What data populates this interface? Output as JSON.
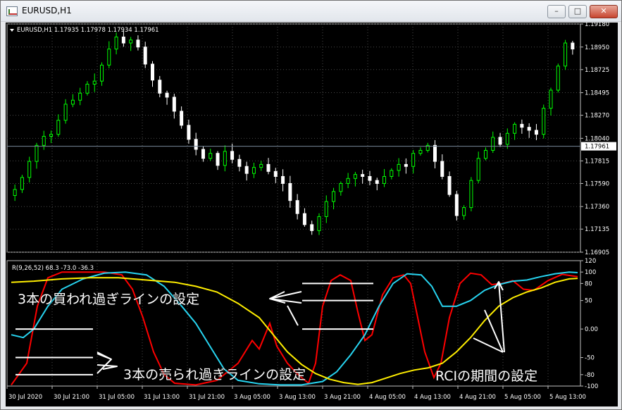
{
  "window": {
    "title": "EURUSD,H1",
    "min_glyph": "–",
    "max_glyph": "□",
    "close_glyph": "✕"
  },
  "price_chart": {
    "header": "EURUSD,H1  1.17935 1.17978 1.17934 1.17961",
    "price_labels": [
      "1.19180",
      "1.18950",
      "1.18725",
      "1.18495",
      "1.18270",
      "1.18040",
      "1.17815",
      "1.17590",
      "1.17360",
      "1.17135",
      "1.16905"
    ],
    "current_price": "1.17961",
    "bull_color": "#00ff00",
    "bear_color": "#ffffff"
  },
  "indicator": {
    "header": "R(9,26,52) 68.3 -73.0 -36.3",
    "levels": [
      "120",
      "100",
      "80",
      "50",
      "0.00",
      "-50",
      "-80",
      "-100"
    ],
    "series_colors": [
      "#ff0000",
      "#27d4f0",
      "#ffee00"
    ]
  },
  "time_labels": [
    "30 Jul 2020",
    "30 Jul 21:00",
    "31 Jul 05:00",
    "31 Jul 13:00",
    "31 Jul 21:00",
    "3 Aug 05:00",
    "3 Aug 13:00",
    "3 Aug 21:00",
    "4 Aug 05:00",
    "4 Aug 13:00",
    "4 Aug 21:00",
    "5 Aug 05:00",
    "5 Aug 13:00"
  ],
  "annotations": {
    "overbought": "3本の買われ過ぎラインの設定",
    "oversold": "3本の売られ過ぎラインの設定",
    "period": "RCIの期間の設定"
  },
  "chart_data": {
    "type": "candlestick",
    "symbol": "EURUSD",
    "timeframe": "H1",
    "ylim": [
      1.16905,
      1.1918
    ],
    "close_series_approx": [
      1.1753,
      1.1765,
      1.1781,
      1.1797,
      1.1806,
      1.1808,
      1.1822,
      1.1838,
      1.1842,
      1.1849,
      1.1858,
      1.1861,
      1.1877,
      1.1893,
      1.1905,
      1.1899,
      1.1902,
      1.1895,
      1.1878,
      1.1862,
      1.1849,
      1.1845,
      1.1831,
      1.1817,
      1.1803,
      1.1793,
      1.1784,
      1.1789,
      1.1777,
      1.1791,
      1.1783,
      1.1776,
      1.1769,
      1.1775,
      1.1778,
      1.1771,
      1.1766,
      1.1759,
      1.1742,
      1.1729,
      1.1718,
      1.1712,
      1.1726,
      1.1741,
      1.1751,
      1.1759,
      1.1764,
      1.1768,
      1.1766,
      1.1762,
      1.1759,
      1.1766,
      1.1772,
      1.1778,
      1.1776,
      1.1789,
      1.1792,
      1.1797,
      1.1781,
      1.1766,
      1.1748,
      1.1727,
      1.1735,
      1.1762,
      1.1784,
      1.1792,
      1.1805,
      1.1798,
      1.1809,
      1.1818,
      1.1815,
      1.1812,
      1.1808,
      1.1834,
      1.1852,
      1.1876,
      1.1899,
      1.1893
    ],
    "indicator": {
      "name": "RCI",
      "periods": [
        9,
        26,
        52
      ],
      "last_values": [
        68.3,
        -73.0,
        -36.3
      ],
      "ylim": [
        -100,
        120
      ],
      "levels": [
        100,
        80,
        50,
        0,
        -50,
        -80,
        -100
      ]
    }
  }
}
